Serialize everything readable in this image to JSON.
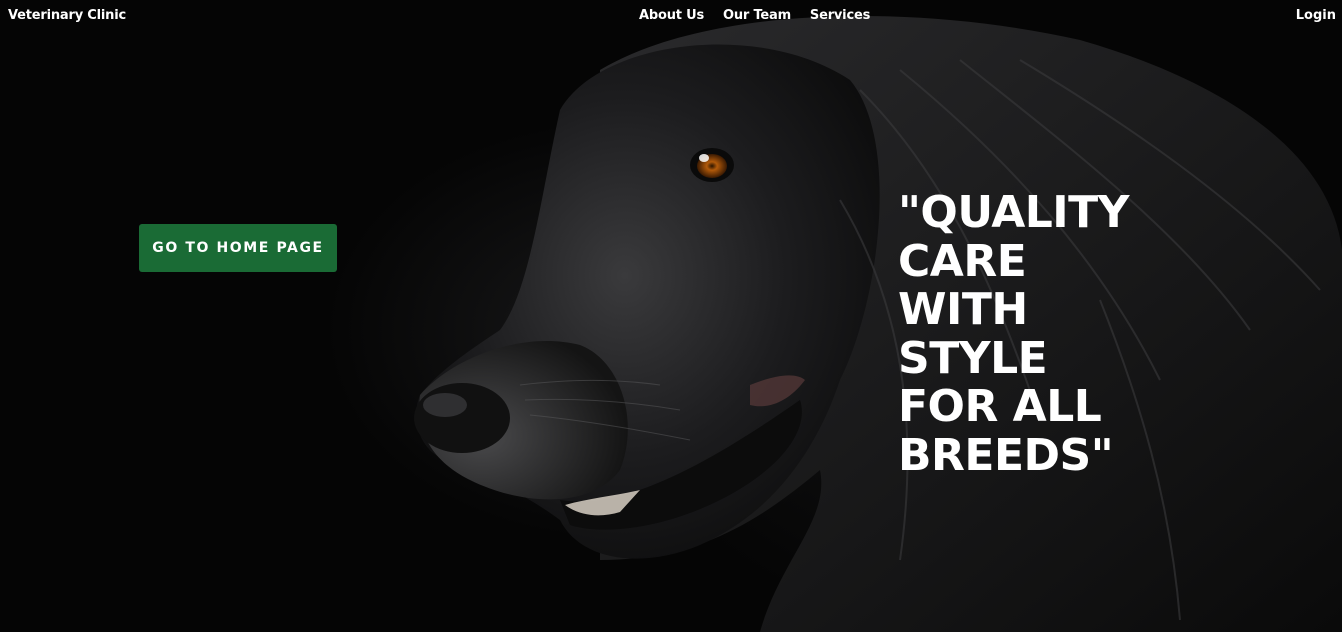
{
  "nav": {
    "brand": "Veterinary Clinic",
    "links": [
      "About Us",
      "Our Team",
      "Services"
    ],
    "login": "Login"
  },
  "hero": {
    "button_label": "GO TO HOME PAGE",
    "tagline": "\"QUALITY CARE WITH STYLE FOR ALL BREEDS\"",
    "image": "black-dog-portrait",
    "button_color": "#1a6b35"
  }
}
